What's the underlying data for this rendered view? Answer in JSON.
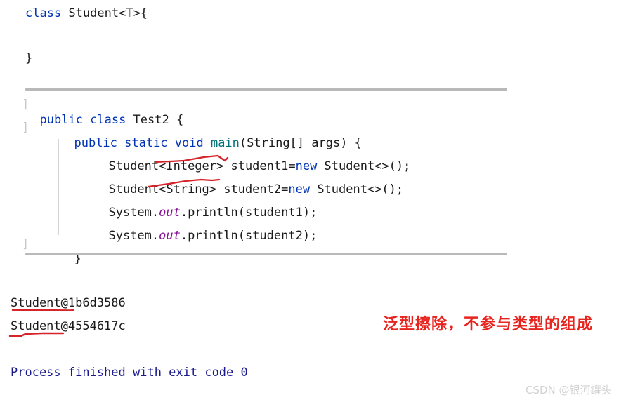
{
  "editor": {
    "top_class": {
      "keyword": "class",
      "rest_before_t": " Student<",
      "generic_param": "T",
      "rest_after_t": ">{",
      "closing_brace": "}"
    },
    "fold_markers": [
      "]",
      "]",
      "]"
    ],
    "lines": [
      {
        "id": "line-class-decl",
        "segments": [
          {
            "text": "public class",
            "style": "kw"
          },
          {
            "text": " Test2 {",
            "style": "plain"
          }
        ]
      },
      {
        "id": "line-main-decl",
        "segments": [
          {
            "text": "public static void ",
            "style": "kw"
          },
          {
            "text": "main",
            "style": "method"
          },
          {
            "text": "(String[] args) {",
            "style": "plain"
          }
        ]
      },
      {
        "id": "line-student1",
        "segments": [
          {
            "text": "Student<Integer> student1=",
            "style": "plain"
          },
          {
            "text": "new",
            "style": "kw"
          },
          {
            "text": " Student<>();",
            "style": "plain"
          }
        ]
      },
      {
        "id": "line-student2",
        "segments": [
          {
            "text": "Student<String> student2=",
            "style": "plain"
          },
          {
            "text": "new",
            "style": "kw"
          },
          {
            "text": " Student<>();",
            "style": "plain"
          }
        ]
      },
      {
        "id": "line-print1",
        "segments": [
          {
            "text": "System.",
            "style": "plain"
          },
          {
            "text": "out",
            "style": "field"
          },
          {
            "text": ".println(student1);",
            "style": "plain"
          }
        ]
      },
      {
        "id": "line-print2",
        "segments": [
          {
            "text": "System.",
            "style": "plain"
          },
          {
            "text": "out",
            "style": "field"
          },
          {
            "text": ".println(student2);",
            "style": "plain"
          }
        ]
      },
      {
        "id": "line-closing-brace",
        "segments": [
          {
            "text": "}",
            "style": "plain"
          }
        ]
      }
    ]
  },
  "console": {
    "output_line_1": "Student@1b6d3586",
    "output_line_2": "Student@4554617c",
    "exit_line": "Process finished with exit code 0"
  },
  "annotation": {
    "red_note": "泛型擦除，不参与类型的组成",
    "red_color": "#e8241f",
    "underline_color": "#d6252a"
  },
  "watermark": {
    "text": "CSDN @银河罐头"
  }
}
